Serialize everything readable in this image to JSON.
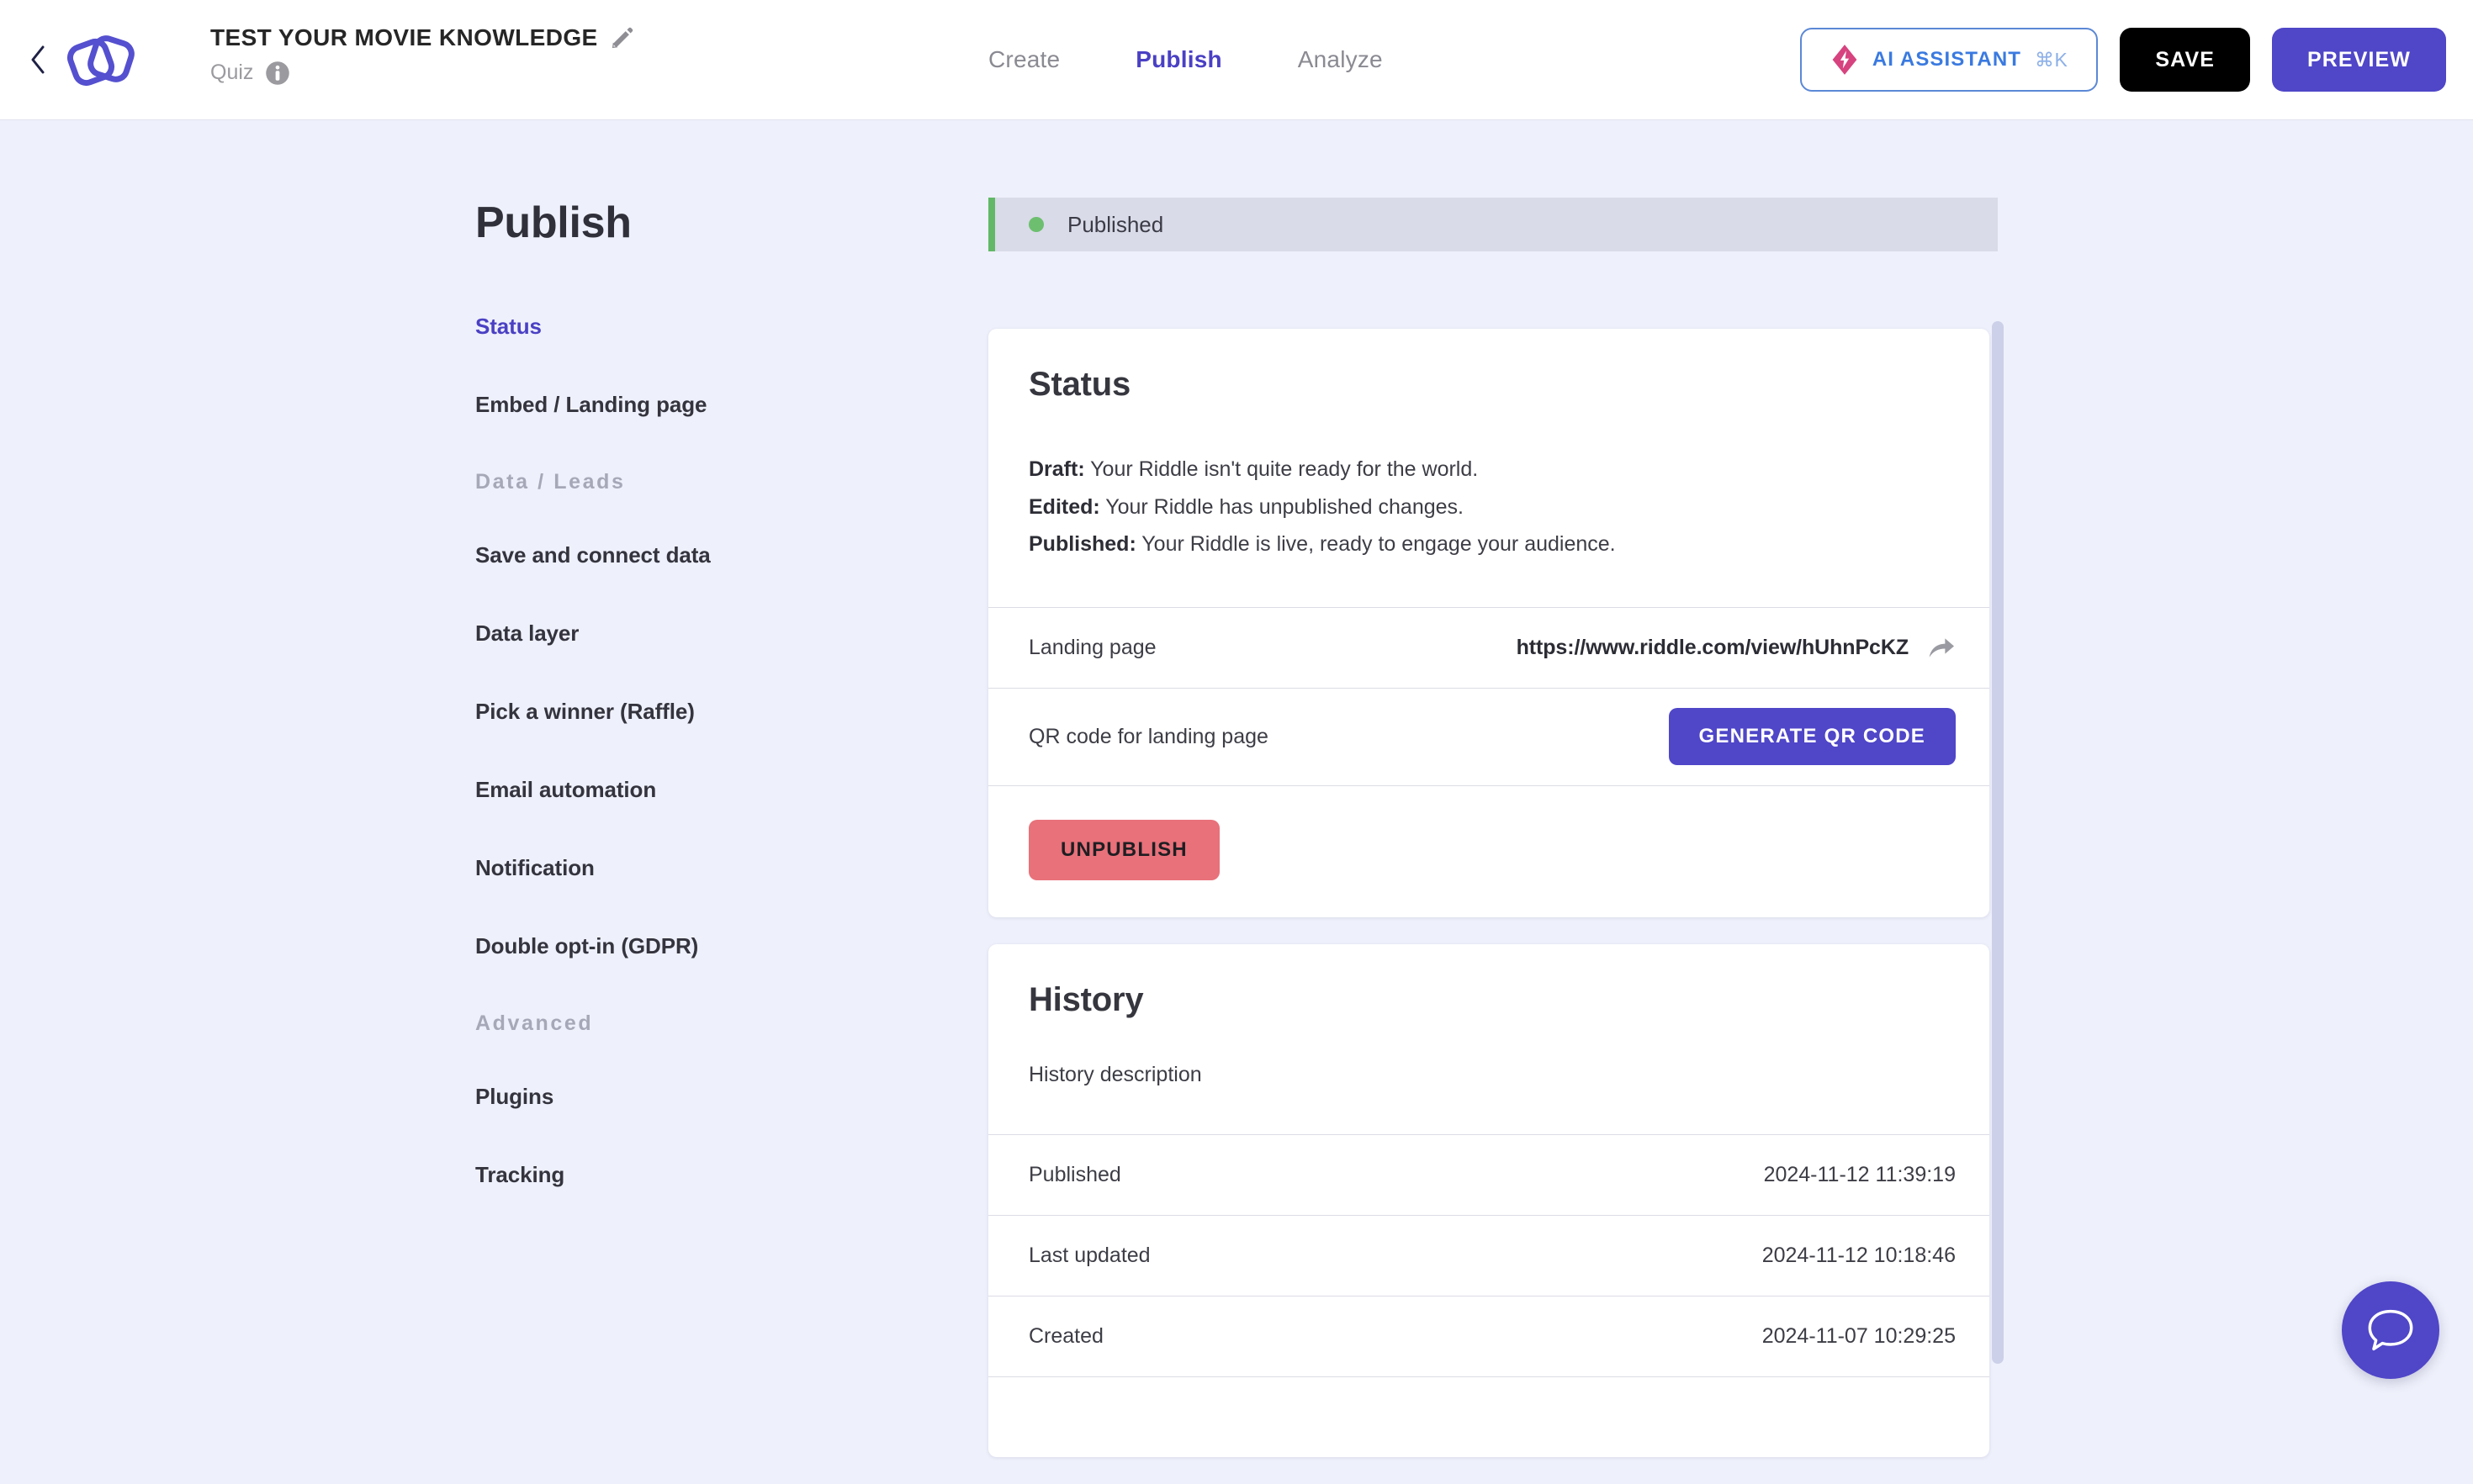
{
  "header": {
    "back_label": "Back",
    "doc_title": "TEST YOUR MOVIE KNOWLEDGE",
    "doc_type": "Quiz",
    "tabs": [
      {
        "label": "Create",
        "active": false
      },
      {
        "label": "Publish",
        "active": true
      },
      {
        "label": "Analyze",
        "active": false
      }
    ],
    "ai_assistant_label": "AI ASSISTANT",
    "ai_assistant_shortcut": "⌘K",
    "save_label": "SAVE",
    "preview_label": "PREVIEW"
  },
  "sidebar": {
    "title": "Publish",
    "items": [
      {
        "label": "Status",
        "active": true,
        "type": "item"
      },
      {
        "label": "Embed / Landing page",
        "active": false,
        "type": "item"
      },
      {
        "label": "Data / Leads",
        "type": "group"
      },
      {
        "label": "Save and connect data",
        "active": false,
        "type": "item"
      },
      {
        "label": "Data layer",
        "active": false,
        "type": "item"
      },
      {
        "label": "Pick a winner (Raffle)",
        "active": false,
        "type": "item"
      },
      {
        "label": "Email automation",
        "active": false,
        "type": "item"
      },
      {
        "label": "Notification",
        "active": false,
        "type": "item"
      },
      {
        "label": "Double opt-in (GDPR)",
        "active": false,
        "type": "item"
      },
      {
        "label": "Advanced",
        "type": "group"
      },
      {
        "label": "Plugins",
        "active": false,
        "type": "item"
      },
      {
        "label": "Tracking",
        "active": false,
        "type": "item"
      }
    ]
  },
  "banner": {
    "label": "Published",
    "accent_color": "#62b867"
  },
  "status_card": {
    "heading": "Status",
    "lines": [
      {
        "term": "Draft:",
        "text": " Your Riddle isn't quite ready for the world."
      },
      {
        "term": "Edited:",
        "text": " Your Riddle has unpublished changes."
      },
      {
        "term": "Published:",
        "text": " Your Riddle is live, ready to engage your audience."
      }
    ],
    "landing_page_label": "Landing page",
    "landing_page_url": "https://www.riddle.com/view/hUhnPcKZ",
    "qr_label": "QR code for landing page",
    "qr_button": "GENERATE QR CODE",
    "unpublish_button": "UNPUBLISH"
  },
  "history_card": {
    "heading": "History",
    "description": "History description",
    "rows": [
      {
        "label": "Published",
        "value": "2024-11-12 11:39:19"
      },
      {
        "label": "Last updated",
        "value": "2024-11-12 10:18:46"
      },
      {
        "label": "Created",
        "value": "2024-11-07 10:29:25"
      }
    ]
  },
  "colors": {
    "brand_purple": "#4f46c8",
    "accent_green": "#62b867",
    "danger_red": "#e8717a",
    "page_bg": "#eef0fb"
  },
  "chat": {
    "tooltip": "Open chat"
  }
}
